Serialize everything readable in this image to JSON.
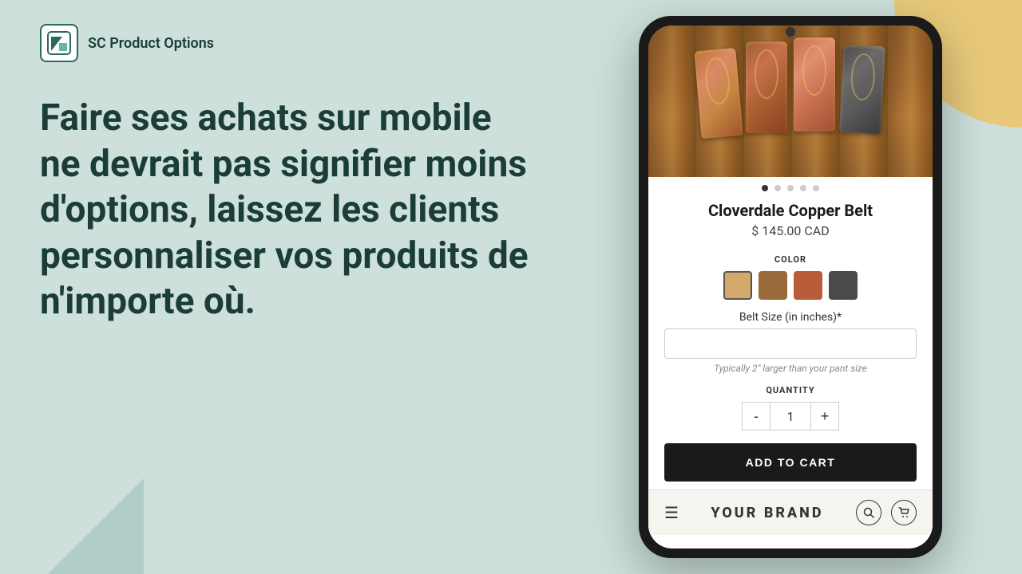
{
  "brand": {
    "name": "SC Product Options",
    "logo_alt": "SC Product Options logo"
  },
  "hero": {
    "text": "Faire ses achats sur mobile ne devrait pas signifier moins d'options, laissez les clients personnaliser vos produits de n'importe où."
  },
  "phone": {
    "product": {
      "title": "Cloverdale Copper Belt",
      "price": "$ 145.00 CAD",
      "image_alt": "Copper belt buckles product image",
      "carousel_dots": 5,
      "active_dot": 0
    },
    "color": {
      "label": "COLOR",
      "swatches": [
        {
          "color": "#d4a96a",
          "selected": true
        },
        {
          "color": "#9a6b3a",
          "selected": false
        },
        {
          "color": "#b85c3a",
          "selected": false
        },
        {
          "color": "#4a4a4a",
          "selected": false
        }
      ]
    },
    "size": {
      "label": "Belt Size (in inches)*",
      "placeholder": "",
      "hint": "Typically 2\" larger than your pant size"
    },
    "quantity": {
      "label": "QUANTITY",
      "value": 1,
      "minus_label": "-",
      "plus_label": "+"
    },
    "add_to_cart": {
      "label": "ADD TO CART"
    },
    "bottom_nav": {
      "brand": "YOUR BRAND",
      "hamburger_icon": "☰",
      "search_icon": "🔍",
      "cart_icon": "🛒"
    }
  }
}
